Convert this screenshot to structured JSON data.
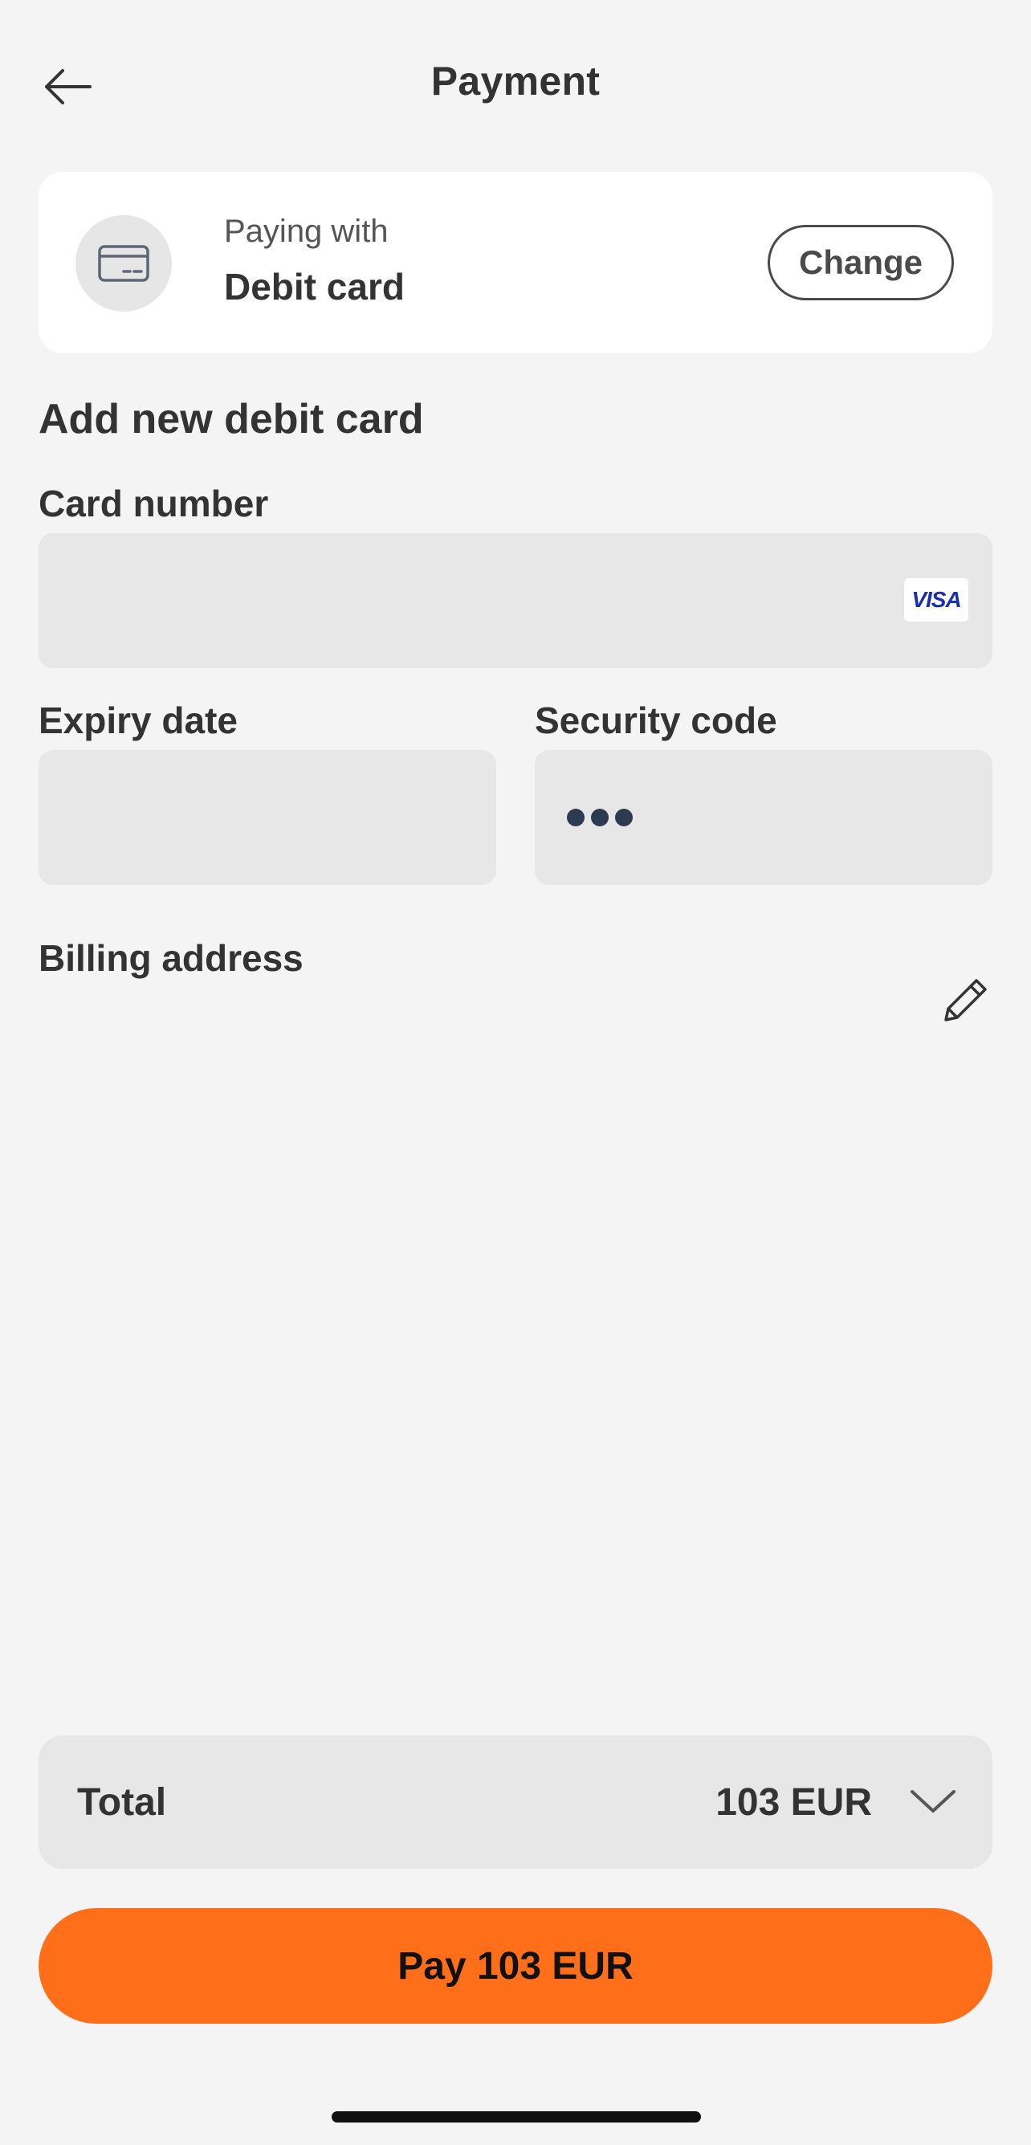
{
  "header": {
    "title": "Payment",
    "back_icon": "arrow-left-icon"
  },
  "payment_method": {
    "icon": "credit-card-icon",
    "subtitle": "Paying with",
    "method": "Debit card",
    "change_label": "Change"
  },
  "form": {
    "section_title": "Add new debit card",
    "card_number_label": "Card number",
    "card_number_value": "",
    "card_brand": "VISA",
    "expiry_label": "Expiry date",
    "expiry_value": "",
    "security_label": "Security code",
    "security_placeholder_icon": "three-dots-icon",
    "billing_label": "Billing address",
    "billing_edit_icon": "pencil-icon"
  },
  "summary": {
    "total_label": "Total",
    "total_amount": "103 EUR",
    "expand_icon": "chevron-down-icon"
  },
  "pay_button_label": "Pay 103 EUR",
  "colors": {
    "background": "#f4f4f4",
    "accent": "#ff6f19",
    "field_background": "#e7e7e7",
    "visa_blue": "#1a2fb0"
  }
}
